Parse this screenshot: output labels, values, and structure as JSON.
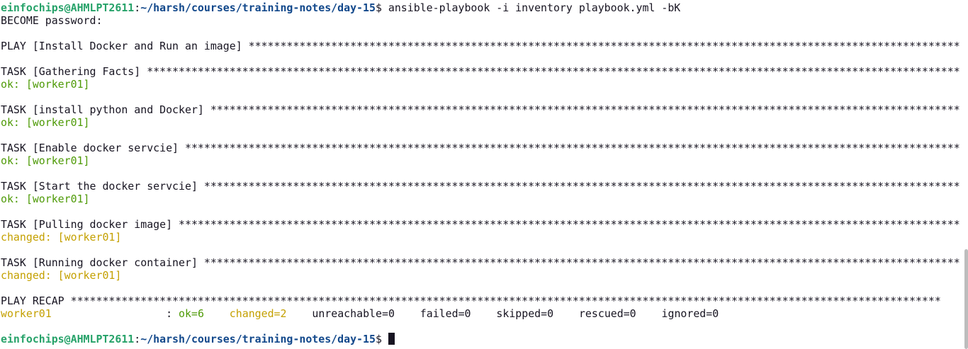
{
  "prompt": {
    "user_host": "einfochips@AHMLPT2611",
    "path": "~/harsh/courses/training-notes/day-15",
    "symbol": "$"
  },
  "command": " ansible-playbook -i inventory playbook.yml -bK",
  "become_prompt": "BECOME password:",
  "play_header": "PLAY [Install Docker and Run an image] *****************************************************************************************************************************************",
  "tasks": [
    {
      "header": "TASK [Gathering Facts] *****************************************************************************************************************************************",
      "result": "ok: [worker01]",
      "status": "ok"
    },
    {
      "header": "TASK [install python and Docker] *****************************************************************************************************************************************",
      "result": "ok: [worker01]",
      "status": "ok"
    },
    {
      "header": "TASK [Enable docker servcie] *****************************************************************************************************************************************",
      "result": "ok: [worker01]",
      "status": "ok"
    },
    {
      "header": "TASK [Start the docker servcie] *****************************************************************************************************************************************",
      "result": "ok: [worker01]",
      "status": "ok"
    },
    {
      "header": "TASK [Pulling docker image] *****************************************************************************************************************************************",
      "result": "changed: [worker01]",
      "status": "changed"
    },
    {
      "header": "TASK [Running docker container] *****************************************************************************************************************************************",
      "result": "changed: [worker01]",
      "status": "changed"
    }
  ],
  "recap": {
    "header": "PLAY RECAP *****************************************************************************************************************************************",
    "host": "worker01",
    "separator": "                  : ",
    "ok": "ok=6",
    "changed": "changed=2",
    "unreachable": "unreachable=0",
    "failed": "failed=0",
    "skipped": "skipped=0",
    "rescued": "rescued=0",
    "ignored": "ignored=0"
  },
  "colors": {
    "background": "#ffffff",
    "text": "#171421",
    "user_host": "#26a269",
    "path": "#12488b",
    "ok": "#4e9a06",
    "changed": "#c4a000"
  }
}
